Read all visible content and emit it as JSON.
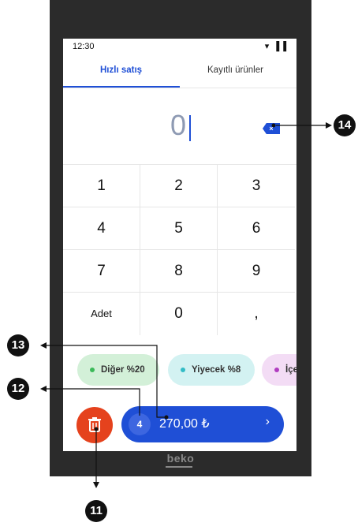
{
  "status_bar": {
    "time": "12:30",
    "icons": [
      "wifi-icon",
      "signal-icon",
      "battery-icon"
    ]
  },
  "tabs": [
    {
      "label": "Hızlı satış",
      "active": true
    },
    {
      "label": "Kayıtlı ürünler",
      "active": false
    }
  ],
  "display": {
    "value": "0",
    "backspace_icon": "backspace-icon",
    "backspace_symbol": "×"
  },
  "keypad": {
    "keys": [
      "1",
      "2",
      "3",
      "4",
      "5",
      "6",
      "7",
      "8",
      "9",
      "Adet",
      "0",
      ","
    ]
  },
  "categories": [
    {
      "label": "Diğer %20",
      "dot_color": "#3cba5a"
    },
    {
      "label": "Yiyecek %8",
      "dot_color": "#33bcc6"
    },
    {
      "label": "İçe",
      "dot_color": "#b13cc0"
    }
  ],
  "cart": {
    "trash_icon": "trash-icon",
    "item_count": "4",
    "total": "270,00 ₺",
    "chevron": "›"
  },
  "brand": "beko",
  "callouts": [
    "11",
    "12",
    "13",
    "14"
  ],
  "colors": {
    "accent": "#1f4fd6",
    "danger": "#e5421d",
    "device": "#2b2b2b"
  }
}
